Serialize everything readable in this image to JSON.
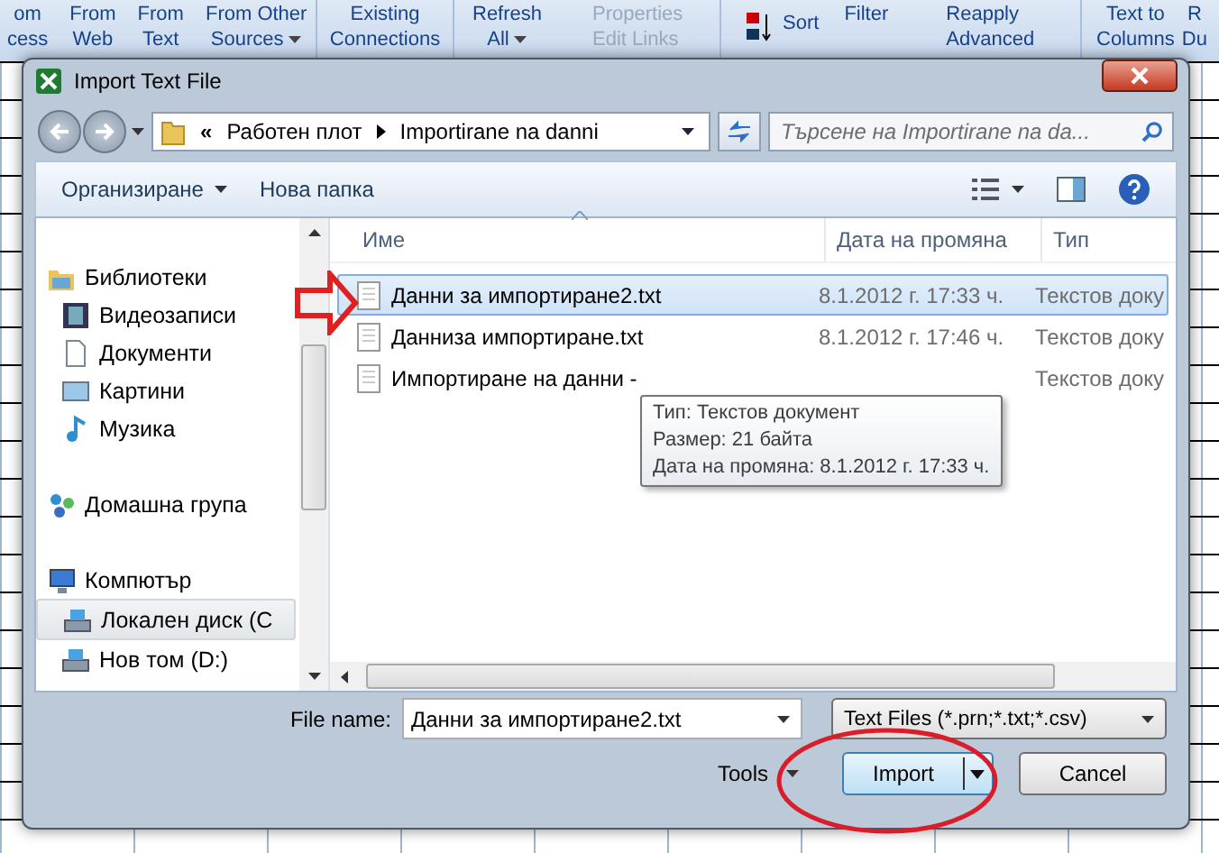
{
  "ribbon": {
    "groups": [
      {
        "items": [
          {
            "kind": "large",
            "lines": [
              "om",
              "cess"
            ],
            "dropdown": false,
            "disabled": false
          },
          {
            "kind": "large",
            "lines": [
              "From",
              "Web"
            ],
            "dropdown": false,
            "disabled": false
          },
          {
            "kind": "large",
            "lines": [
              "From",
              "Text"
            ],
            "dropdown": false,
            "disabled": false
          },
          {
            "kind": "large",
            "lines": [
              "From Other",
              "Sources"
            ],
            "dropdown": true,
            "disabled": false
          }
        ]
      },
      {
        "items": [
          {
            "kind": "large",
            "lines": [
              "Existing",
              "Connections"
            ],
            "dropdown": false,
            "disabled": false
          }
        ]
      },
      {
        "items": [
          {
            "kind": "large",
            "lines": [
              "Refresh",
              "All"
            ],
            "dropdown": true,
            "disabled": false
          },
          {
            "kind": "small",
            "lines": [
              "Properties",
              "Edit Links"
            ],
            "disabled": true
          }
        ]
      },
      {
        "items": [
          {
            "kind": "sort",
            "lines": [
              "Sort"
            ],
            "dropdown": false,
            "disabled": false
          },
          {
            "kind": "large",
            "lines": [
              "Filter"
            ],
            "dropdown": false,
            "disabled": false
          },
          {
            "kind": "small",
            "lines": [
              "Reapply",
              "Advanced"
            ],
            "disabled": false
          }
        ]
      },
      {
        "items": [
          {
            "kind": "large",
            "lines": [
              "Text to",
              "Columns"
            ],
            "dropdown": false,
            "disabled": false
          },
          {
            "kind": "large",
            "lines": [
              "R",
              "Du"
            ],
            "dropdown": false,
            "disabled": false
          }
        ]
      }
    ]
  },
  "dialog": {
    "title": "Import Text File",
    "breadcrumb_overflow": "«",
    "breadcrumb": [
      "Работен плот",
      "Importirane na danni"
    ],
    "search": {
      "placeholder": "Търсене на Importirane na da..."
    },
    "toolbar": {
      "organize": "Организиране",
      "new_folder": "Нова папка"
    },
    "nav": [
      {
        "label": "Библиотеки",
        "selected": false,
        "children": [
          {
            "label": "Видеозаписи",
            "selected": false
          },
          {
            "label": "Документи",
            "selected": false
          },
          {
            "label": "Картини",
            "selected": false
          },
          {
            "label": "Музика",
            "selected": false
          }
        ]
      },
      {
        "label": "Домашна група",
        "selected": false
      },
      {
        "label": "Компютър",
        "selected": false,
        "children": [
          {
            "label": "Локален диск (C",
            "selected": true
          },
          {
            "label": "Нов том (D:)",
            "selected": false
          }
        ]
      }
    ],
    "columns": [
      "Име",
      "Дата на промяна",
      "Тип"
    ],
    "files": [
      {
        "name": "Данни за импортиране2.txt",
        "date": "8.1.2012 г. 17:33 ч.",
        "type": "Текстов доку",
        "selected": true
      },
      {
        "name": "Данниза импортиране.txt",
        "date": "8.1.2012 г. 17:46 ч.",
        "type": "Текстов доку",
        "selected": false
      },
      {
        "name": "Импортиране на данни -",
        "type": "Текстов доку",
        "selected": false
      }
    ],
    "tooltip": [
      "Тип: Текстов документ",
      "Размер: 21 байта",
      "Дата на промяна: 8.1.2012 г. 17:33 ч."
    ],
    "file_name": {
      "label": "File name:",
      "value": "Данни за импортиране2.txt"
    },
    "file_type": "Text Files (*.prn;*.txt;*.csv)",
    "tools": "Tools",
    "buttons": {
      "import": "Import",
      "cancel": "Cancel"
    }
  }
}
